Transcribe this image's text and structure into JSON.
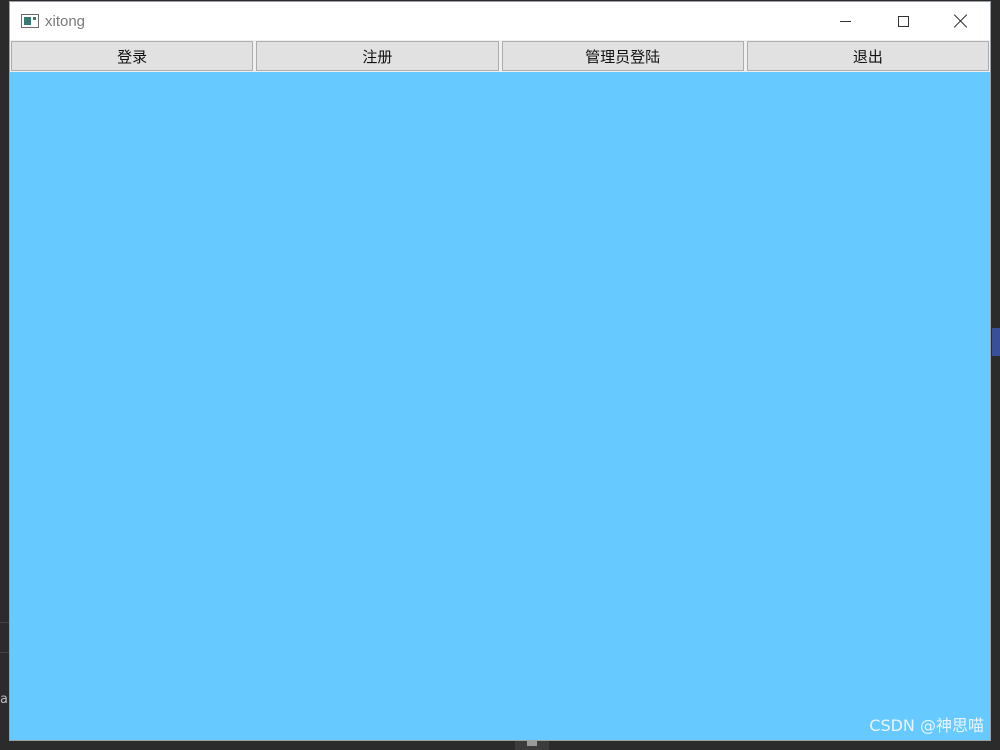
{
  "window": {
    "title": "xitong",
    "icon": "app-window-icon"
  },
  "toolbar": {
    "buttons": [
      "登录",
      "注册",
      "管理员登陆",
      "退出"
    ]
  },
  "content": {
    "background": "#66c9ff"
  },
  "watermark": "CSDN @神思喵",
  "background_glyph": "a"
}
